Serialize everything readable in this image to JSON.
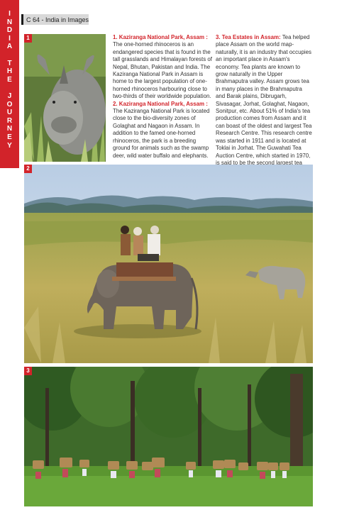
{
  "sidebar": {
    "letters": [
      "I",
      "N",
      "D",
      "I",
      "A",
      "",
      "T",
      "H",
      "E",
      "",
      "J",
      "O",
      "U",
      "R",
      "N",
      "E",
      "Y"
    ]
  },
  "header": {
    "page_label": "C 64 - India in Images"
  },
  "photos": {
    "n1": "1",
    "n2": "2",
    "n3": "3"
  },
  "col1": {
    "h1": "1. Kaziranga National Park, Assam :",
    "t1": "The one-horned rhinoceros is an endangered species that is found in the tall grasslands and Himalayan forests of Nepal, Bhutan, Pakistan and India. The Kaziranga National Park in Assam is home to the largest population of one-horned rhinoceros harbouring close to two-thirds of their worldwide population.",
    "h2": "2. Kaziranga National Park, Assam :",
    "t2": "The Kaziranga National Park is located close to the bio-diversity zones of Golaghat and Nagaon in Assam. In addition to the famed one-horned rhinoceros, the park is a breeding ground for animals such as the swamp deer, wild water buffalo and elephants."
  },
  "col2": {
    "h3": "3. Tea Estates in Assam:",
    "t3": "Tea helped place Assam on the world map-naturally, it is an industry that occupies an important place in Assam's economy. Tea plants are known to grow naturally in the Upper Brahmaputra valley.  Assam grows tea in many places in the Brahmaputra and Barak plains, Dibrugarh, Sivasagar, Jorhat, Golaghat, Nagaon, Sonitpur, etc. About  51% of India's tea production comes from Assam and it can boast of the oldest and largest Tea Research Centre. This research centre was started in 1911 and is located at Toklai in Jorhat. The Guwahati Tea Auction Centre, which started in 1970, is said to be the second largest tea auction centre in the world."
  }
}
